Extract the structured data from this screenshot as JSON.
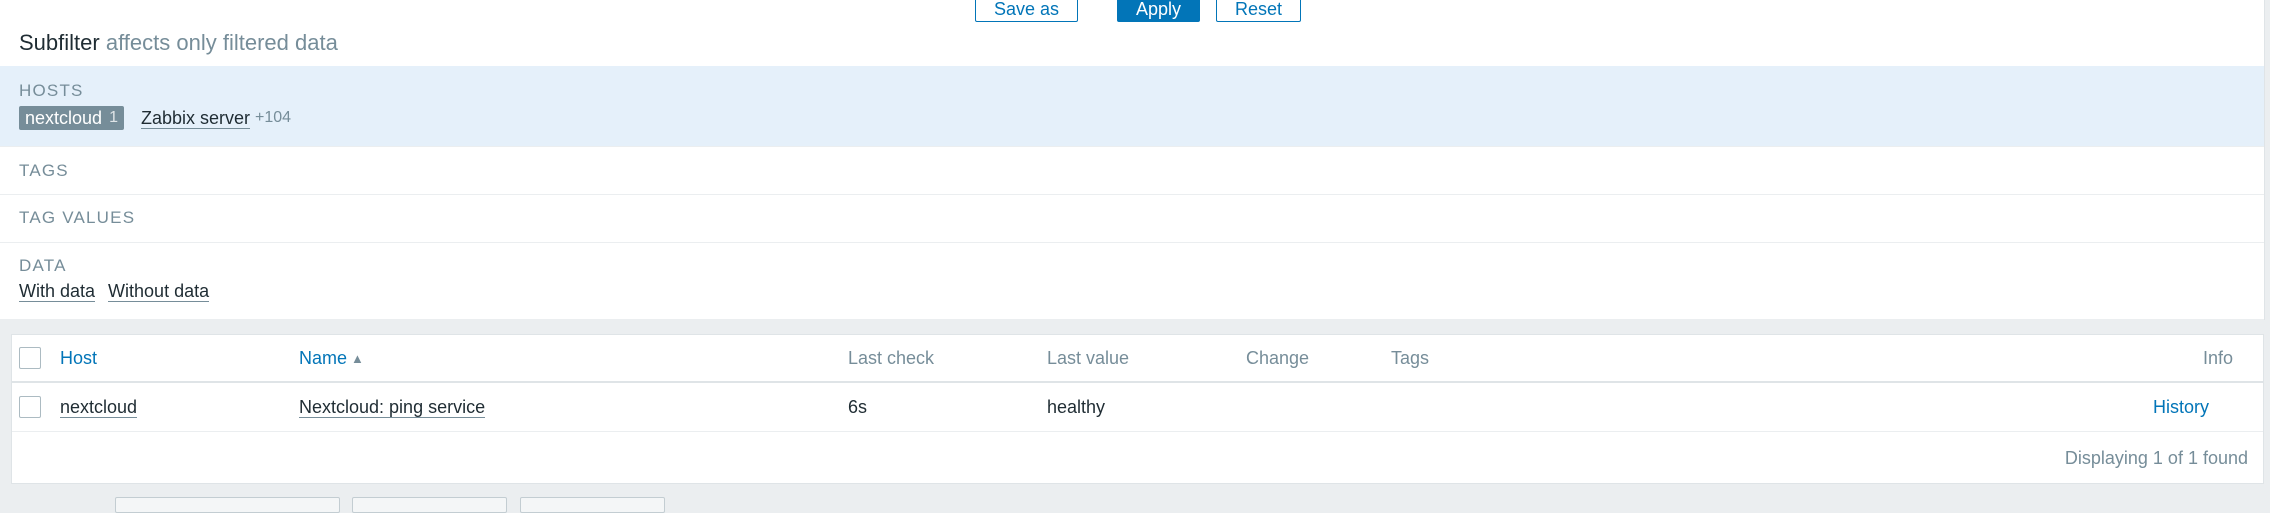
{
  "filter_buttons": {
    "save_as": "Save as",
    "apply": "Apply",
    "reset": "Reset"
  },
  "subfilter": {
    "title": "Subfilter",
    "hint": "affects only filtered data",
    "hosts": {
      "label": "HOSTS",
      "selected": {
        "name": "nextcloud",
        "count": "1"
      },
      "items": [
        {
          "name": "Zabbix server",
          "more": "+104"
        }
      ]
    },
    "tags": {
      "label": "TAGS"
    },
    "tag_values": {
      "label": "TAG VALUES"
    },
    "data": {
      "label": "DATA",
      "items": [
        "With data",
        "Without data"
      ]
    }
  },
  "table": {
    "columns": {
      "host": "Host",
      "name": "Name",
      "last_check": "Last check",
      "last_value": "Last value",
      "change": "Change",
      "tags": "Tags",
      "info": "Info"
    },
    "sort_indicator": "▲",
    "rows": [
      {
        "host": "nextcloud",
        "name": "Nextcloud: ping service",
        "last_check": "6s",
        "last_value": "healthy",
        "change": "",
        "tags": "",
        "info_link": "History"
      }
    ],
    "footer": "Displaying 1 of 1 found"
  },
  "colors": {
    "accent": "#0275b8",
    "muted": "#768d99",
    "highlight_row": "#e5f0fa",
    "background": "#ebeef0"
  }
}
